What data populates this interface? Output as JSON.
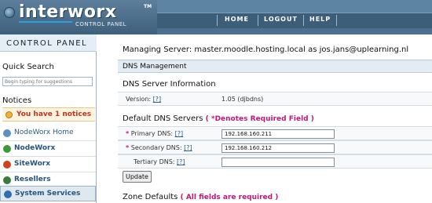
{
  "header": {
    "logo_text": "interworx",
    "logo_tm": "TM",
    "logo_subtitle": "CONTROL PANEL",
    "nav": [
      "HOME",
      "LOGOUT",
      "HELP"
    ]
  },
  "sidebar": {
    "title": "CONTROL PANEL",
    "quick_search_heading": "Quick Search",
    "search_placeholder": "Begin typing for suggestions",
    "notices_heading": "Notices",
    "notice_text": "You have 1 notices",
    "menu": [
      {
        "label": "NodeWorx Home",
        "icon": "home-icon",
        "color": "#5d8fc0"
      },
      {
        "label": "NodeWorx",
        "icon": "nodeworx-icon",
        "color": "#3a9a3a"
      },
      {
        "label": "SiteWorx",
        "icon": "siteworx-icon",
        "color": "#d0421e"
      },
      {
        "label": "Resellers",
        "icon": "resellers-icon",
        "color": "#3a7a3a"
      },
      {
        "label": "System Services",
        "icon": "services-icon",
        "color": "#2e6fb0"
      }
    ]
  },
  "main": {
    "managing_prefix": "Managing Server:",
    "managing_server": "master.moodle.hosting.local",
    "managing_as": "as",
    "managing_user": "jos.jans@uplearning.nl",
    "section_title": "DNS Management",
    "server_info_title": "DNS Server Information",
    "version_label": "Version:",
    "version_value": "1.05 (djbdns)",
    "default_dns_title": "Default DNS Servers",
    "required_note": "( *Denotes Required Field )",
    "help_label": "[?]",
    "primary_label": "Primary DNS:",
    "primary_value": "192.168.160.211",
    "secondary_label": "Secondary DNS:",
    "secondary_value": "192.168.160.212",
    "tertiary_label": "Tertiary DNS:",
    "tertiary_value": "",
    "update_button": "Update",
    "zone_defaults_title": "Zone Defaults",
    "zone_required_note": "( All fields are required )"
  },
  "colors": {
    "header": "#4b6f8d",
    "accent_magenta": "#c0187a",
    "notice_red": "#c4321c"
  }
}
